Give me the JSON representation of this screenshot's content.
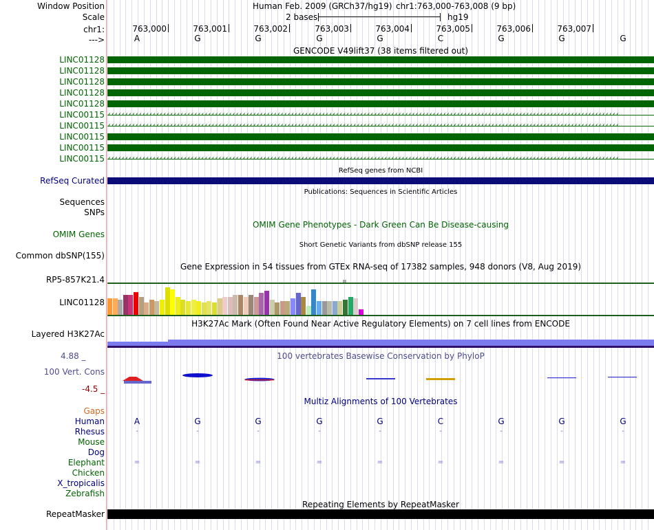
{
  "header": {
    "window_position_label": "Window Position",
    "scale_label": "Scale",
    "chrom_label": "chr1:",
    "strand_label": "--->",
    "assembly_text": "Human Feb. 2009 (GRCh37/hg19)",
    "position_text": "chr1:763,000-763,008 (9 bp)",
    "scale_text": "2 bases",
    "db_text": "hg19",
    "coords": [
      "763,000",
      "763,001",
      "763,002",
      "763,003",
      "763,004",
      "763,005",
      "763,006",
      "763,007"
    ],
    "bases": [
      "A",
      "G",
      "G",
      "G",
      "G",
      "C",
      "G",
      "G",
      "G"
    ]
  },
  "gencode": {
    "title": "GENCODE V49lift37 (38 items filtered out)",
    "rows": [
      {
        "label": "LINC01128",
        "style": "solid"
      },
      {
        "label": "LINC01128",
        "style": "solid"
      },
      {
        "label": "LINC01128",
        "style": "solid"
      },
      {
        "label": "LINC01128",
        "style": "solid"
      },
      {
        "label": "LINC01128",
        "style": "solid"
      },
      {
        "label": "LINC00115",
        "style": "arrow"
      },
      {
        "label": "LINC00115",
        "style": "arrow"
      },
      {
        "label": "LINC00115",
        "style": "solid"
      },
      {
        "label": "LINC00115",
        "style": "solid"
      },
      {
        "label": "LINC00115",
        "style": "arrow"
      }
    ],
    "arrow_text": "‹‹‹‹‹‹‹‹‹‹‹‹‹‹‹‹‹‹‹‹‹‹‹‹‹‹‹‹‹‹‹‹‹‹‹‹‹‹‹‹‹‹‹‹‹‹‹‹‹‹‹‹‹‹‹‹‹‹‹‹‹‹‹‹‹‹‹‹‹‹‹‹‹‹‹‹‹‹‹‹‹‹‹‹‹‹‹‹‹‹‹‹‹‹‹‹‹‹‹‹‹‹‹‹‹‹‹‹‹‹‹‹‹‹‹‹‹‹‹‹‹‹‹‹‹‹‹‹‹‹‹‹‹‹‹‹‹‹‹‹‹‹‹‹‹‹‹‹"
  },
  "refseq": {
    "title": "RefSeq genes from NCBI",
    "label": "RefSeq Curated"
  },
  "publications": {
    "title": "Publications: Sequences in Scientific Articles",
    "label_sequences": "Sequences",
    "label_snps": "SNPs"
  },
  "omim": {
    "title": "OMIM Gene Phenotypes - Dark Green Can Be Disease-causing",
    "label": "OMIM Genes"
  },
  "dbsnp": {
    "title": "Short Genetic Variants from dbSNP release 155",
    "label": "Common dbSNP(155)"
  },
  "gtex": {
    "title": "Gene Expression in 54 tissues from GTEx RNA-seq of 17382 samples, 948 donors (V8, Aug 2019)",
    "label_top": "RP5-857K21.4",
    "label_main": "LINC01128",
    "colors": [
      "#ff9933",
      "#ffaa55",
      "#aaaaaa",
      "#993366",
      "#cc3377",
      "#ee0000",
      "#b0a080",
      "#ddaa88",
      "#cc9966",
      "#c6b89a",
      "#eeee00",
      "#dddd00",
      "#ffff00",
      "#eeee11",
      "#dddd22",
      "#e8e833",
      "#eeee44",
      "#eded22",
      "#e0e050",
      "#e4e466",
      "#dcdc33",
      "#ddcc88",
      "#eecccc",
      "#ddbbbb",
      "#ccbbaa",
      "#aa8866",
      "#eeccbb",
      "#998877",
      "#cc9999",
      "#aa66aa",
      "#9933aa",
      "#ccccaa",
      "#aa9966",
      "#cc9988",
      "#bbaa77",
      "#8888ff",
      "#6666cc",
      "#aa8844",
      "#bbeebb",
      "#3388cc",
      "#66aaee",
      "#999999",
      "#bbbbaa",
      "#88aacc",
      "#cccc99",
      "#337733",
      "#22aa66",
      "#ddcccc",
      "#dd00dd"
    ],
    "heights": [
      0.55,
      0.55,
      0.5,
      0.65,
      0.65,
      0.75,
      0.58,
      0.42,
      0.5,
      0.45,
      0.5,
      0.9,
      0.85,
      0.6,
      0.5,
      0.45,
      0.5,
      0.45,
      0.4,
      0.45,
      0.4,
      0.55,
      0.6,
      0.6,
      0.65,
      0.65,
      0.6,
      0.65,
      0.6,
      0.72,
      0.8,
      0.5,
      0.4,
      0.45,
      0.45,
      0.55,
      0.72,
      0.6,
      0.3,
      0.85,
      0.45,
      0.45,
      0.45,
      0.45,
      0.45,
      0.5,
      0.58,
      0.55,
      0.18
    ]
  },
  "h3k27ac": {
    "title": "H3K27Ac Mark (Often Found Near Active Regulatory Elements) on 7 cell lines from ENCODE",
    "label": "Layered H3K27Ac"
  },
  "phylop": {
    "title": "100 vertebrates Basewise Conservation by PhyloP",
    "label": "100 Vert. Cons",
    "max": "4.88 _",
    "min": "-4.5 _"
  },
  "multiz": {
    "title": "Multiz Alignments of 100 Vertebrates",
    "rows": [
      {
        "label": "Gaps",
        "color": "#d2691e",
        "cells": [
          "",
          "",
          "",
          "",
          "",
          "",
          "",
          "",
          ""
        ]
      },
      {
        "label": "Human",
        "color": "#000080",
        "cells": [
          "A",
          "G",
          "G",
          "G",
          "G",
          "C",
          "G",
          "G",
          "G"
        ]
      },
      {
        "label": "Rhesus",
        "color": "#000080",
        "cells": [
          "-",
          "-",
          "-",
          "-",
          "-",
          "-",
          "-",
          "-",
          "-"
        ]
      },
      {
        "label": "Mouse",
        "color": "#006400",
        "cells": [
          "",
          "",
          "",
          "",
          "",
          "",
          "",
          "",
          ""
        ]
      },
      {
        "label": "Dog",
        "color": "#000080",
        "cells": [
          "",
          "",
          "",
          "",
          "",
          "",
          "",
          "",
          ""
        ]
      },
      {
        "label": "Elephant",
        "color": "#006400",
        "cells": [
          "=",
          "=",
          "=",
          "=",
          "=",
          "=",
          "=",
          "=",
          "="
        ]
      },
      {
        "label": "Chicken",
        "color": "#006400",
        "cells": [
          "",
          "",
          "",
          "",
          "",
          "",
          "",
          "",
          ""
        ]
      },
      {
        "label": "X_tropicalis",
        "color": "#000080",
        "cells": [
          "",
          "",
          "",
          "",
          "",
          "",
          "",
          "",
          ""
        ]
      },
      {
        "label": "Zebrafish",
        "color": "#006400",
        "cells": [
          "",
          "",
          "",
          "",
          "",
          "",
          "",
          "",
          ""
        ]
      }
    ]
  },
  "repeatmasker": {
    "title": "Repeating Elements by RepeatMasker",
    "label": "RepeatMasker"
  }
}
